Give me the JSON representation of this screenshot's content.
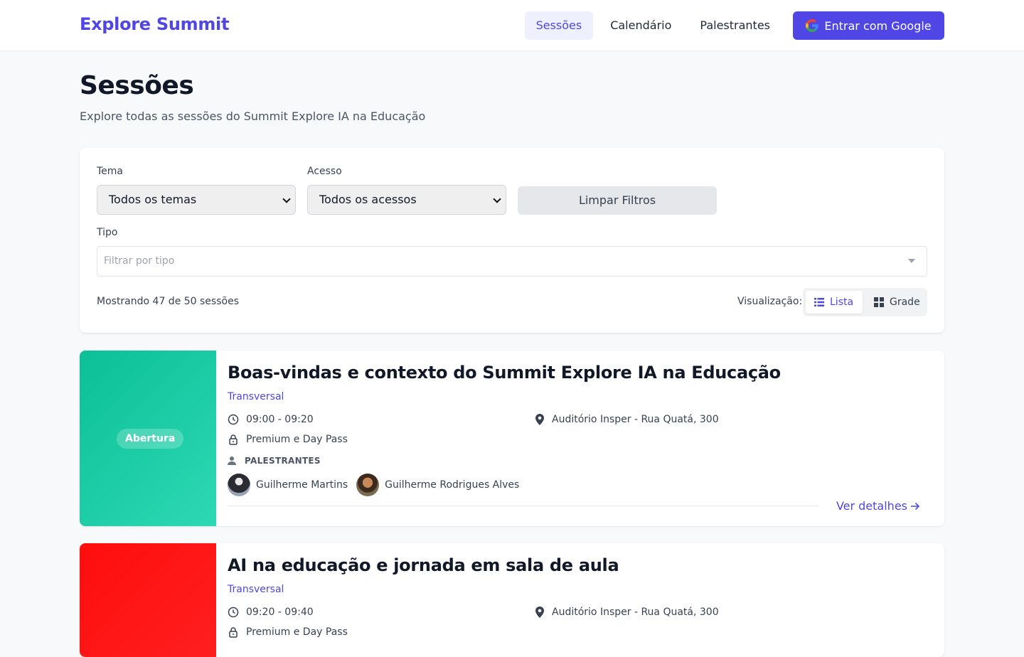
{
  "header": {
    "logo": "Explore Summit",
    "nav": [
      "Sessões",
      "Calendário",
      "Palestrantes"
    ],
    "login_label": "Entrar com Google"
  },
  "page": {
    "title": "Sessões",
    "subtitle": "Explore todas as sessões do Summit Explore IA na Educação"
  },
  "filters": {
    "tema_label": "Tema",
    "tema_value": "Todos os temas",
    "acesso_label": "Acesso",
    "acesso_value": "Todos os acessos",
    "clear_label": "Limpar Filtros",
    "tipo_label": "Tipo",
    "tipo_placeholder": "Filtrar por tipo",
    "count_text": "Mostrando 47 de 50 sessões",
    "view_label": "Visualização:",
    "view_list": "Lista",
    "view_grid": "Grade"
  },
  "sessions": [
    {
      "badge": "Abertura",
      "title": "Boas-vindas e contexto do Summit Explore IA na Educação",
      "theme": "Transversal",
      "time": "09:00 - 09:20",
      "location": "Auditório Insper - Rua Quatá, 300",
      "access": "Premium e Day Pass",
      "speakers_label": "PALESTRANTES",
      "speakers": [
        "Guilherme Martins",
        "Guilherme Rodrigues Alves"
      ],
      "details_label": "Ver detalhes",
      "color": "#0bbf96"
    },
    {
      "badge": "",
      "title": "AI na educação e jornada em sala de aula",
      "theme": "Transversal",
      "time": "09:20 - 09:40",
      "location": "Auditório Insper - Rua Quatá, 300",
      "access": "Premium e Day Pass",
      "color": "#ff0d0d"
    }
  ],
  "colors": {
    "accent": "#4f46e5",
    "background": "#f8f9fb"
  }
}
